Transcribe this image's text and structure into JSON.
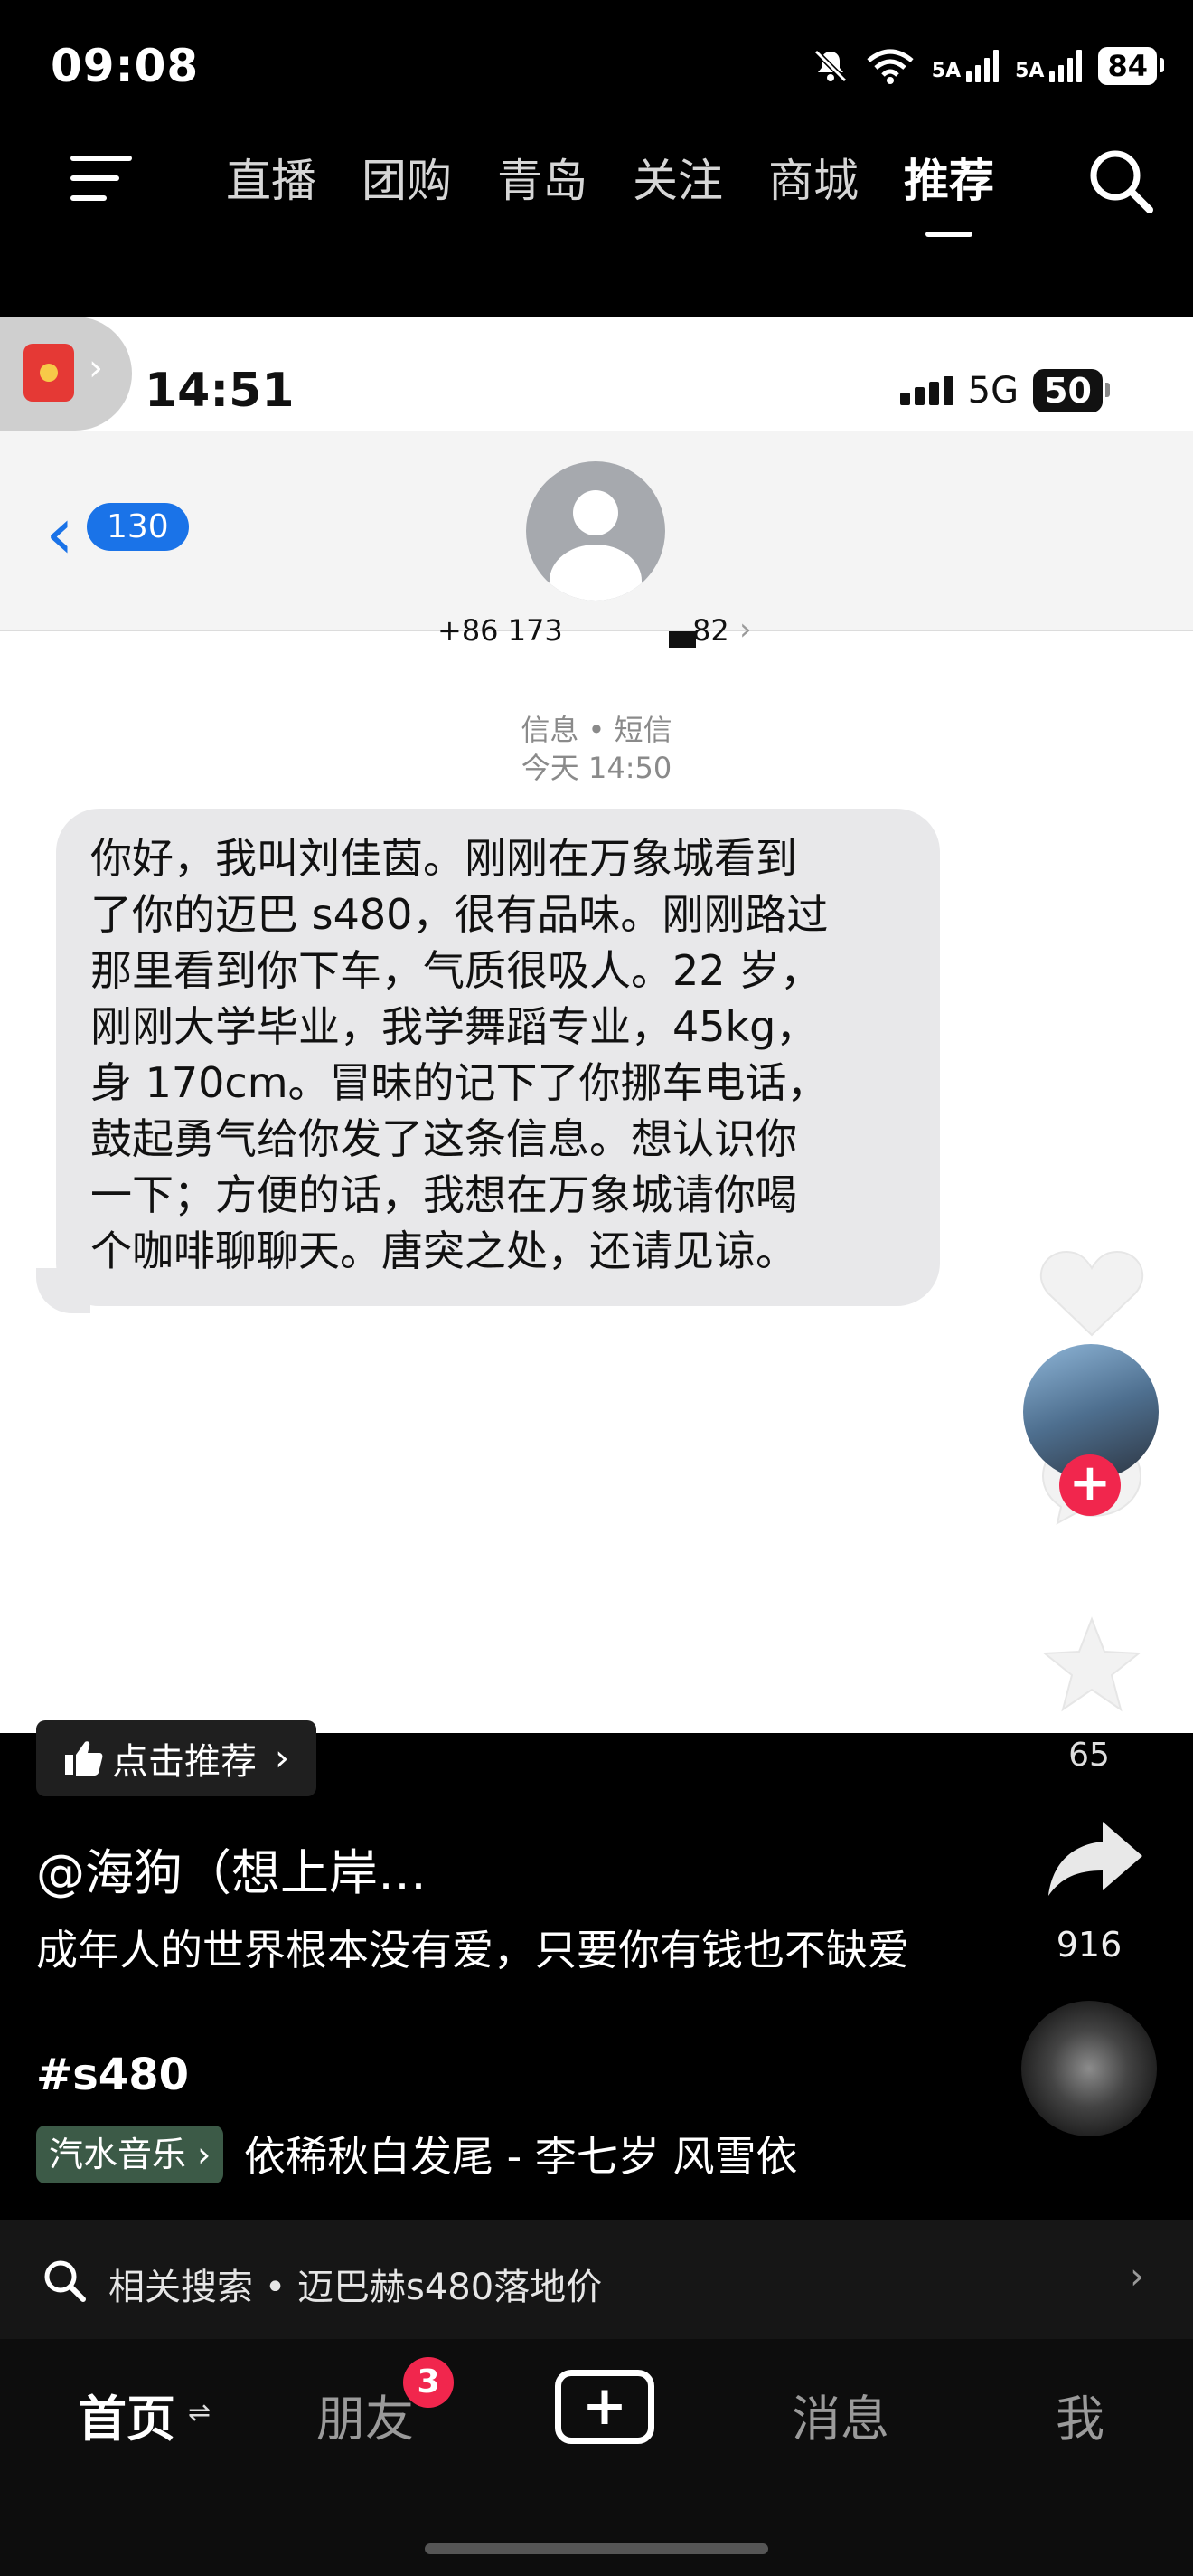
{
  "status_bar": {
    "time": "09:08",
    "network1": "5A",
    "network2": "5A",
    "battery": "84",
    "icons": [
      "mute-bell-icon",
      "wifi-icon",
      "signal-icon",
      "signal-icon",
      "battery-icon"
    ]
  },
  "top_nav": {
    "tabs": [
      "直播",
      "团购",
      "青岛",
      "关注",
      "商城",
      "推荐"
    ],
    "active_tab": "推荐"
  },
  "video": {
    "phone_time": "14:51",
    "phone_network": "5G",
    "phone_battery": "50",
    "back_badge": "130",
    "contact_number_left": "+86 173",
    "contact_number_right": "82",
    "service": "信息 • 短信",
    "timestamp": "今天 14:50",
    "message_lines": [
      "你好，我叫刘佳茵。刚刚在万象城看到",
      "了你的迈巴 s480，很有品味。刚刚路过",
      "那里看到你下车，气质很吸人。22 岁，",
      "刚刚大学毕业，我学舞蹈专业，45kg，",
      "身 170cm。冒昧的记下了你挪车电话，",
      "鼓起勇气给你发了这条信息。想认识你",
      "一下；方便的话，我想在万象城请你喝",
      "个咖啡聊聊天。唐突之处，还请见谅。"
    ]
  },
  "overlay": {
    "recommend_label": "点击推荐",
    "like_count": "65",
    "author": "@海狗（想上岸…",
    "caption": "成年人的世界根本没有爱，只要你有钱也不缺爱",
    "hashtag": "#s480",
    "music_tag": "汽水音乐",
    "music_text": "依稀秋白发尾 - 李七岁  风雪依",
    "share_count": "916",
    "related_search": "相关搜索 • 迈巴赫s480落地价"
  },
  "bottom_nav": {
    "home": "首页",
    "home_suffix": "⇌",
    "friends": "朋友",
    "friends_badge": "3",
    "create": "+",
    "messages": "消息",
    "me": "我"
  },
  "colors": {
    "accent_red": "#f1264d",
    "ios_blue": "#1a73e8",
    "bubble_grey": "#e8e8ea",
    "music_tag_green": "#3c5a47"
  }
}
